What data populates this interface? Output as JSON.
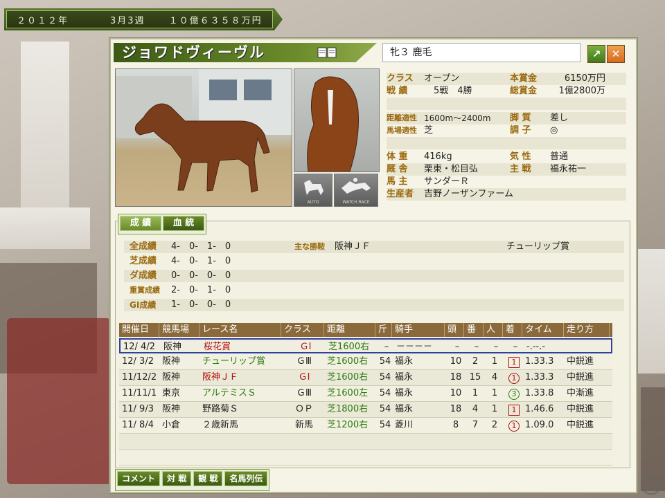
{
  "topbar": {
    "year": "２０１２年",
    "week": "3月3週",
    "money": "１０億６３５８万円"
  },
  "horse": {
    "name": "ジョワドヴィーヴル",
    "attr": "牝３ 鹿毛"
  },
  "icons": {
    "auto": "AUTO",
    "watch": "WATCH RACE"
  },
  "stats": {
    "class_label": "クラス",
    "class_val": "オープン",
    "prize_label": "本賞金",
    "prize_val": "6150万円",
    "record_label": "戦 績",
    "record_val": "5戦　4勝",
    "total_label": "総賞金",
    "total_val": "1億2800万円",
    "dist_label": "距離適性",
    "dist_val": "1600m〜2400m",
    "leg_label": "脚 質",
    "leg_val": "差し",
    "track_label": "馬場適性",
    "track_val": "芝",
    "cond_label": "調 子",
    "cond_val": "◎",
    "weight_label": "体 重",
    "weight_val": "416kg",
    "temper_label": "気 性",
    "temper_val": "普通",
    "stable_label": "厩 舎",
    "stable_val": "栗東・松目弘",
    "jockey_label": "主 戦",
    "jockey_val": "福永祐一",
    "owner_label": "馬 主",
    "owner_val": "サンダーＲ",
    "breeder_label": "生産者",
    "breeder_val": "吉野ノーザンファーム"
  },
  "tabs": [
    "成 績",
    "血 統"
  ],
  "summary": {
    "all_label": "全成績",
    "all_val": "4-　0-　1-　0",
    "turf_label": "芝成績",
    "turf_val": "4-　0-　1-　0",
    "dirt_label": "ダ成績",
    "dirt_val": "0-　0-　0-　0",
    "graded_label": "重賞成績",
    "graded_val": "2-　0-　1-　0",
    "g1_label": "GⅠ成績",
    "g1_val": "1-　0-　0-　0",
    "wins_label": "主な勝鞍",
    "wins_val1": "阪神ＪＦ",
    "wins_val2": "チューリップ賞"
  },
  "table": {
    "headers": [
      "開催日",
      "競馬場",
      "レース名",
      "クラス",
      "距離",
      "斤",
      "騎手",
      "頭",
      "番",
      "人",
      "着",
      "タイム",
      "走り方"
    ],
    "rows": [
      {
        "date": "12/ 4/2",
        "course": "阪神",
        "race": "桜花賞",
        "cls": "ＧⅠ",
        "dist": "芝1600右",
        "kin": "–",
        "jockey": "－－－－",
        "heads": "–",
        "num": "–",
        "pop": "–",
        "place": "–",
        "time": "-.--.-",
        "style": ""
      },
      {
        "date": "12/ 3/2",
        "course": "阪神",
        "race": "チューリップ賞",
        "cls": "ＧⅢ",
        "dist": "芝1600右",
        "kin": "54",
        "jockey": "福永",
        "heads": "10",
        "num": "2",
        "pop": "1",
        "place": "1",
        "time": "1.33.3",
        "style": "中鋭進"
      },
      {
        "date": "11/12/2",
        "course": "阪神",
        "race": "阪神ＪＦ",
        "cls": "ＧⅠ",
        "dist": "芝1600右",
        "kin": "54",
        "jockey": "福永",
        "heads": "18",
        "num": "15",
        "pop": "4",
        "place": "1",
        "time": "1.33.3",
        "style": "中鋭進"
      },
      {
        "date": "11/11/1",
        "course": "東京",
        "race": "アルテミスＳ",
        "cls": "ＧⅢ",
        "dist": "芝1600左",
        "kin": "54",
        "jockey": "福永",
        "heads": "10",
        "num": "1",
        "pop": "1",
        "place": "3",
        "time": "1.33.8",
        "style": "中漸進"
      },
      {
        "date": "11/ 9/3",
        "course": "阪神",
        "race": "野路菊Ｓ",
        "cls": "ＯＰ",
        "dist": "芝1800右",
        "kin": "54",
        "jockey": "福永",
        "heads": "18",
        "num": "4",
        "pop": "1",
        "place": "1",
        "time": "1.46.6",
        "style": "中鋭進"
      },
      {
        "date": "11/ 8/4",
        "course": "小倉",
        "race": "２歳新馬",
        "cls": "新馬",
        "dist": "芝1200右",
        "kin": "54",
        "jockey": "菱川",
        "heads": "8",
        "num": "7",
        "pop": "2",
        "place": "1",
        "time": "1.09.0",
        "style": "中鋭進"
      }
    ]
  },
  "buttons": [
    "コメント",
    "対 戦",
    "観 戦",
    "名馬列伝"
  ]
}
